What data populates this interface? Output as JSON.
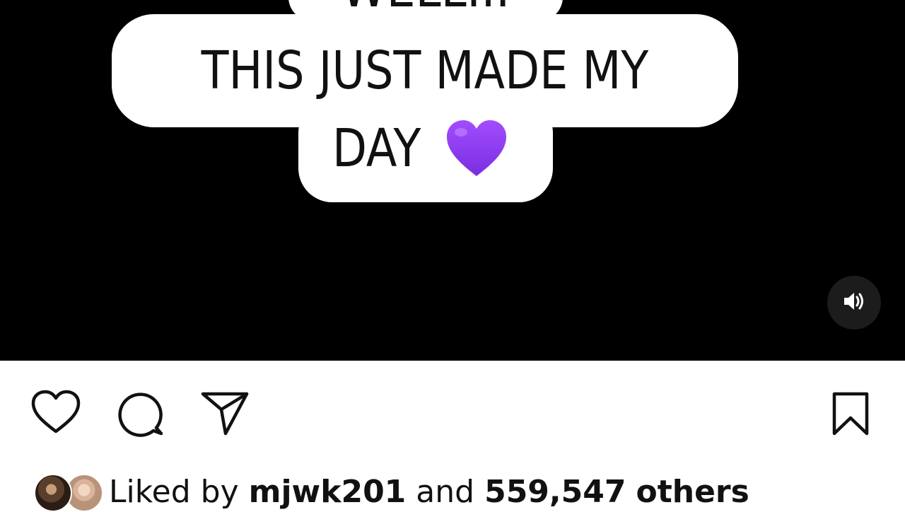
{
  "video": {
    "caption_top": "WELL...",
    "caption_line1": "THIS JUST MADE MY",
    "caption_line2": "DAY",
    "caption_emoji": "purple-heart",
    "audio_icon": "speaker-on-icon"
  },
  "actions": {
    "like_icon": "heart-outline-icon",
    "comment_icon": "comment-bubble-icon",
    "share_icon": "paper-plane-icon",
    "save_icon": "bookmark-icon"
  },
  "likes": {
    "prefix": "Liked by",
    "user": "mjwk201",
    "middle": "and",
    "count": "559,547",
    "suffix": "others"
  },
  "colors": {
    "video_bg": "#000000",
    "caption_bg": "#ffffff",
    "caption_text": "#111111",
    "emoji_purple": "#8b3ff0",
    "page_bg": "#ffffff"
  }
}
